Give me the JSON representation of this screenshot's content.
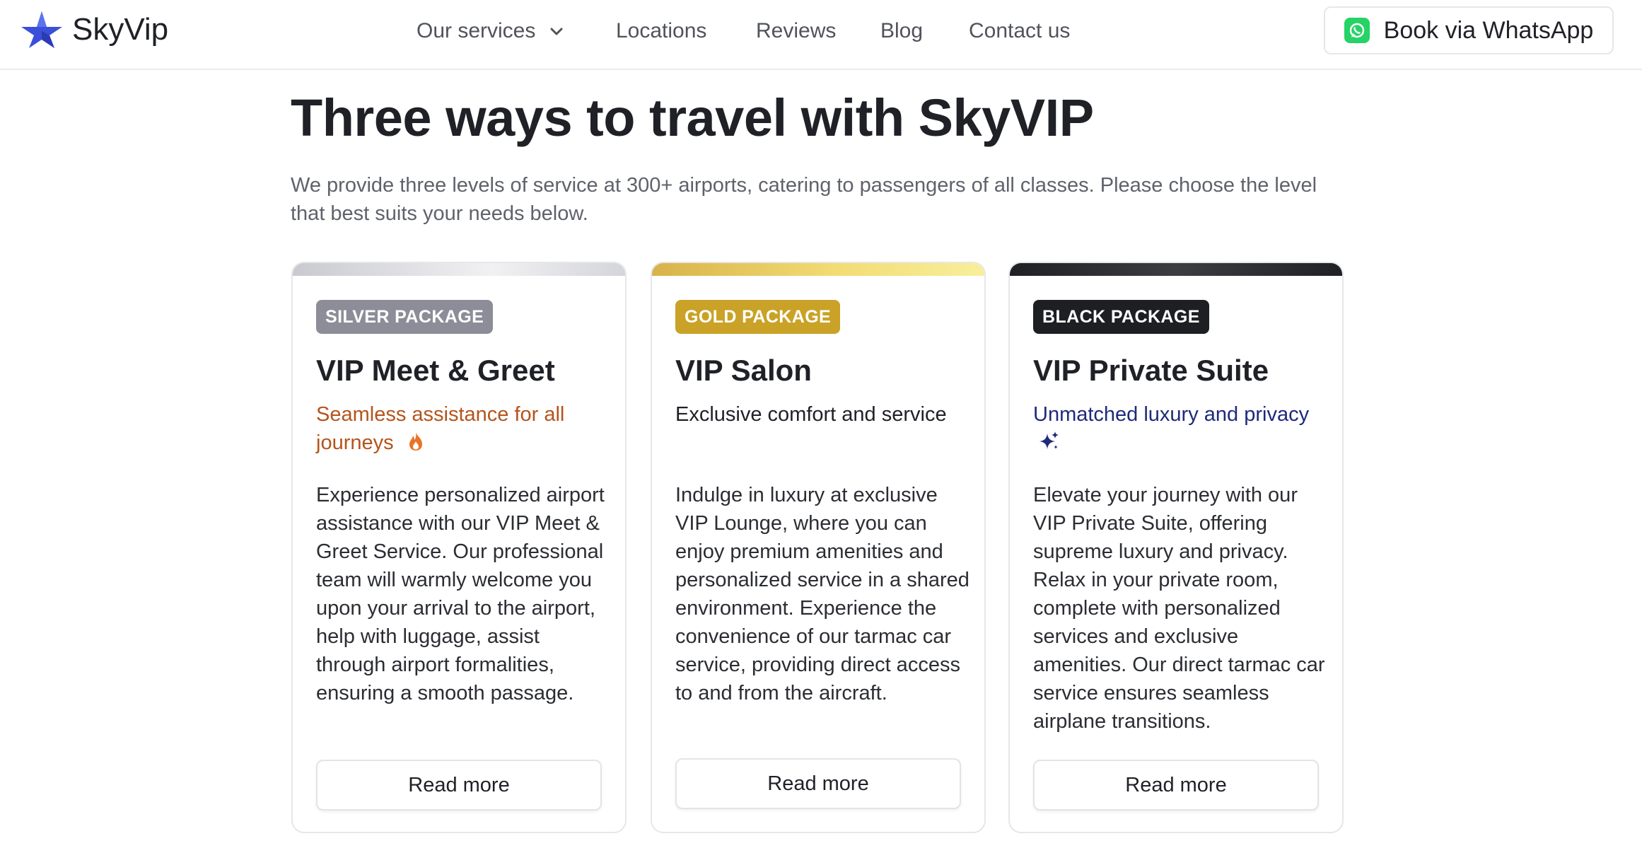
{
  "brand": {
    "name": "SkyVip"
  },
  "nav": {
    "services": "Our services",
    "locations": "Locations",
    "reviews": "Reviews",
    "blog": "Blog",
    "contact": "Contact us"
  },
  "cta": {
    "whatsapp_label": "Book via WhatsApp"
  },
  "hero": {
    "title": "Three ways to travel with SkyVIP",
    "intro": "We provide three levels of service at 300+ airports, catering to passengers of all classes. Please choose the level that best suits your needs below."
  },
  "packages": [
    {
      "badge": "SILVER PACKAGE",
      "title": "VIP Meet & Greet",
      "tagline": "Seamless assistance for all journeys",
      "tagline_icon": "fire-icon",
      "description": "Experience personalized airport assistance with our VIP Meet & Greet Service. Our professional team will warmly welcome you upon your arrival to the airport, help with luggage, assist through airport formalities, ensuring a smooth passage.",
      "button": "Read more"
    },
    {
      "badge": "GOLD PACKAGE",
      "title": "VIP Salon",
      "tagline": "Exclusive comfort and service",
      "description": "Indulge in luxury at exclusive VIP Lounge, where you can enjoy premium amenities and personalized service in a shared environment. Experience the convenience of our tarmac car service, providing direct access to and from the aircraft.",
      "button": "Read more"
    },
    {
      "badge": "BLACK PACKAGE",
      "title": "VIP Private Suite",
      "tagline": "Unmatched luxury and privacy",
      "tagline_icon": "sparkles-icon",
      "description": "Elevate your journey with our VIP Private Suite, offering supreme luxury and privacy. Relax in your private room, complete with personalized services and exclusive amenities. Our direct tarmac car service ensures seamless airplane transitions.",
      "button": "Read more"
    }
  ],
  "colors": {
    "silver_badge": "#8c8d98",
    "gold_badge": "#c9a227",
    "black_badge": "#1e1f23",
    "silver_tagline": "#b4541c",
    "black_tagline": "#1f2a7a",
    "whatsapp_green": "#25d366",
    "logo_blue": "#3b4fd8"
  }
}
